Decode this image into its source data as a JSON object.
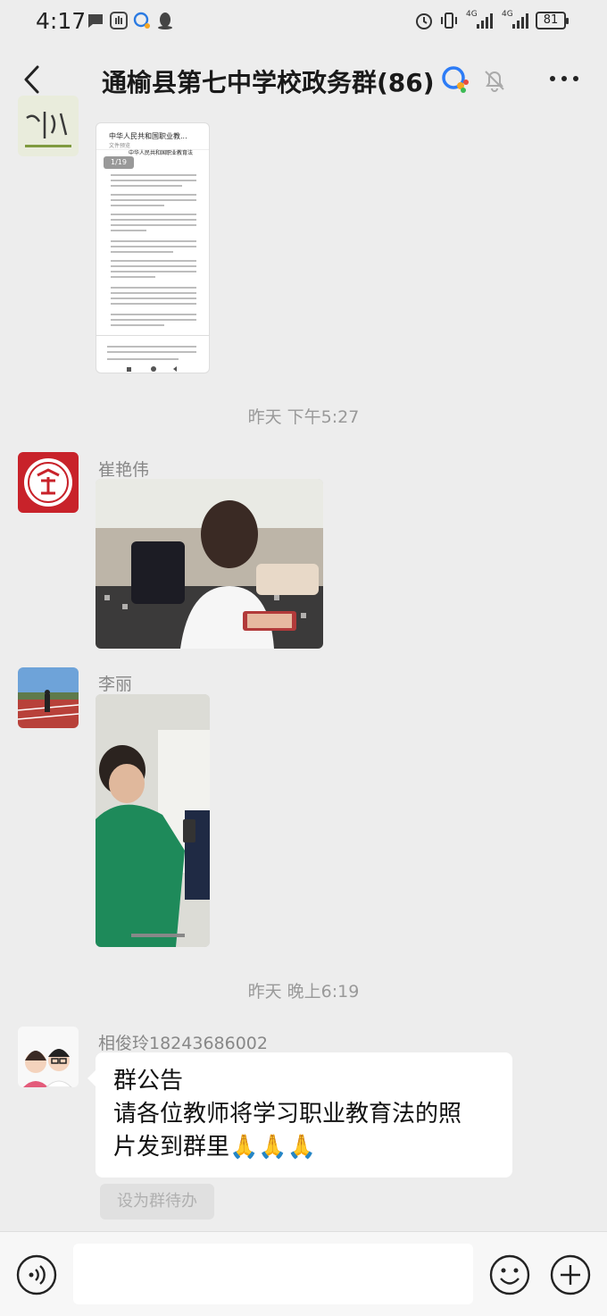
{
  "status_bar": {
    "time": "4:17",
    "network_1": "4G",
    "network_2": "4G",
    "battery": "81"
  },
  "header": {
    "title": "通榆县第七中学校政务群(86)"
  },
  "messages": {
    "doc_preview": {
      "doc_title": "中华人民共和国职业教...",
      "doc_subtitle": "文件预览",
      "page_indicator": "1/19",
      "heading": "中华人民共和国职业教育法"
    },
    "timestamp_1": "昨天 下午5:27",
    "msg_cui": {
      "sender": "崔艳伟"
    },
    "msg_li": {
      "sender": "李丽"
    },
    "timestamp_2": "昨天 晚上6:19",
    "msg_xiang": {
      "sender": "相俊玲18243686002",
      "line1": "群公告",
      "line2": "请各位教师将学习职业教育法的照",
      "line3": "片发到群里🙏🙏🙏",
      "action": "设为群待办"
    }
  },
  "input_bar": {
    "placeholder": ""
  },
  "icons": {
    "back": "back-arrow-icon",
    "wecom": "wecom-badge-icon",
    "mute": "mute-bell-icon",
    "more": "more-dots-icon",
    "voice": "voice-icon",
    "emoji": "emoji-icon",
    "plus": "plus-icon"
  }
}
